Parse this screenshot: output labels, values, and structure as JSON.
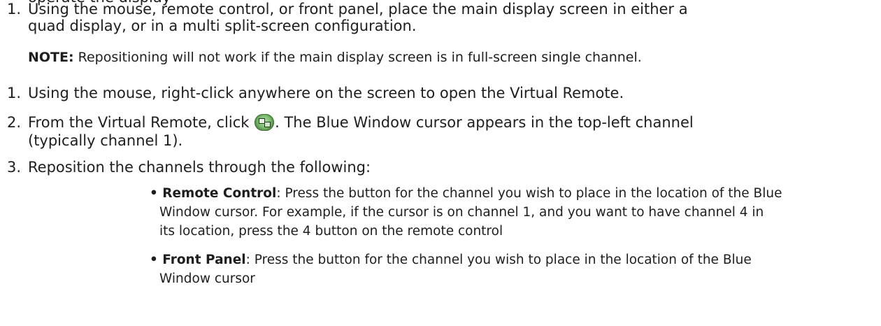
{
  "top_fragment": "operate the display",
  "steps_a": [
    {
      "number": "1.",
      "line1": "Using the mouse, remote control, or front panel, place the main display screen in either a",
      "line2": "quad display, or in a multi split-screen configuration."
    }
  ],
  "note": {
    "label": "NOTE:",
    "text": " Repositioning will not work if the main display screen is in full-screen single channel."
  },
  "steps_b": [
    {
      "number": "1.",
      "text": "Using the mouse, right-click anywhere on the screen to open the Virtual Remote."
    },
    {
      "number": "2.",
      "before_icon": "From the Virtual Remote, click ",
      "icon": "channel-swap-icon",
      "after_icon": ". The Blue Window cursor appears in the top-left channel",
      "line2": "(typically channel 1)."
    },
    {
      "number": "3.",
      "text": "Reposition the channels through the following:"
    }
  ],
  "bullets": [
    {
      "label": "Remote Control",
      "line1": ": Press the button for the channel you wish to place in the location of the Blue",
      "line2": "Window cursor. For example, if the cursor is on channel 1, and you want to have channel 4 in",
      "line3": "its location, press the 4 button on the remote control"
    },
    {
      "label": "Front Panel",
      "line1": ": Press the button for the channel you wish to place in the location of the Blue",
      "line2": "Window cursor"
    }
  ]
}
